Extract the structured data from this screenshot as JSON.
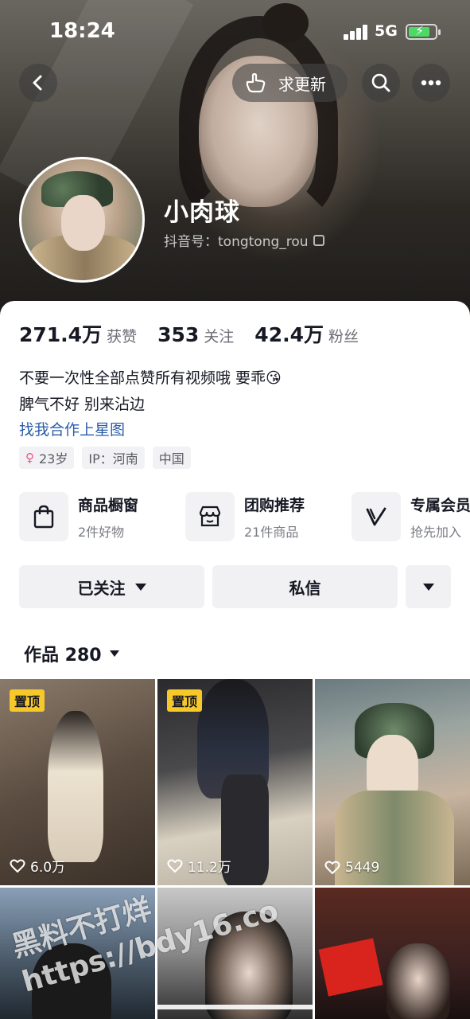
{
  "status_bar": {
    "time": "18:24",
    "network": "5G"
  },
  "header": {
    "update_button_label": "求更新",
    "name": "小肉球",
    "douyin_id": "抖音号：tongtong_rou"
  },
  "stats": [
    {
      "value": "271.4万",
      "label": "获赞"
    },
    {
      "value": "353",
      "label": "关注"
    },
    {
      "value": "42.4万",
      "label": "粉丝"
    }
  ],
  "bio": {
    "line1": "不要一次性全部点赞所有视频哦 要乖😘",
    "line2": "脾气不好 别来沾边",
    "link": "找我合作上星图"
  },
  "tags": [
    {
      "icon": "female-icon",
      "label": "23岁"
    },
    {
      "label": "IP：河南"
    },
    {
      "label": "中国"
    }
  ],
  "shops": [
    {
      "icon": "shopping-bag-icon",
      "title": "商品橱窗",
      "subtitle": "2件好物"
    },
    {
      "icon": "store-icon",
      "title": "团购推荐",
      "subtitle": "21件商品"
    },
    {
      "icon": "vip-v-icon",
      "title": "专属会员",
      "subtitle": "抢先加入"
    }
  ],
  "actions": {
    "follow": "已关注",
    "message": "私信"
  },
  "works": {
    "label": "作品 280"
  },
  "videos": [
    {
      "pinned": "置顶",
      "likes": "6.0万"
    },
    {
      "pinned": "置顶",
      "likes": "11.2万"
    },
    {
      "likes": "5449"
    },
    {},
    {},
    {}
  ],
  "watermark": {
    "line1": "黑料不打烊",
    "line2": "https://bdy16.co"
  },
  "colors": {
    "accent_link": "#2b5da8",
    "pin_badge": "#f7c829",
    "battery": "#4cd964"
  }
}
